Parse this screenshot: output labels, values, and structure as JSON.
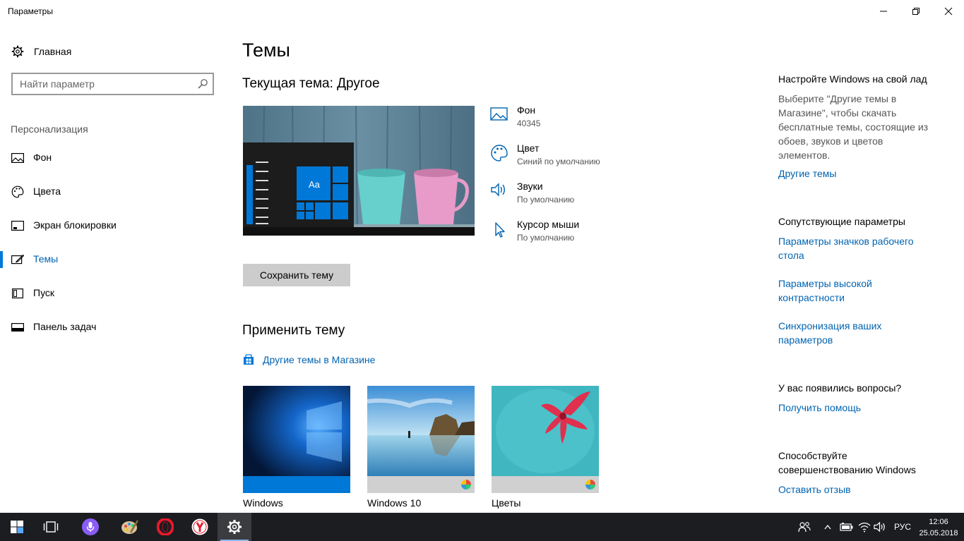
{
  "window": {
    "title": "Параметры"
  },
  "sidebar": {
    "home": "Главная",
    "search_placeholder": "Найти параметр",
    "section": "Персонализация",
    "items": [
      {
        "label": "Фон",
        "icon": "picture-icon"
      },
      {
        "label": "Цвета",
        "icon": "palette-icon"
      },
      {
        "label": "Экран блокировки",
        "icon": "lock-screen-icon"
      },
      {
        "label": "Темы",
        "icon": "themes-icon",
        "active": true
      },
      {
        "label": "Пуск",
        "icon": "start-icon"
      },
      {
        "label": "Панель задач",
        "icon": "taskbar-icon"
      }
    ]
  },
  "main": {
    "title": "Темы",
    "current_theme": "Текущая тема: Другое",
    "preview_tile_text": "Aa",
    "props": [
      {
        "name": "Фон",
        "value": "40345",
        "icon": "picture-icon"
      },
      {
        "name": "Цвет",
        "value": "Синий по умолчанию",
        "icon": "palette-icon"
      },
      {
        "name": "Звуки",
        "value": "По умолчанию",
        "icon": "speaker-icon"
      },
      {
        "name": "Курсор мыши",
        "value": "По умолчанию",
        "icon": "cursor-icon"
      }
    ],
    "save_button": "Сохранить тему",
    "apply_title": "Применить тему",
    "store_link": "Другие темы в Магазине",
    "themes": [
      {
        "name": "Windows"
      },
      {
        "name": "Windows 10"
      },
      {
        "name": "Цветы"
      }
    ]
  },
  "right": {
    "customize_title": "Настройте Windows на свой лад",
    "customize_text_lines": [
      "Выберите \"Другие темы в",
      "Магазине\", чтобы скачать",
      "бесплатные темы, состоящие из",
      "обоев, звуков и цветов",
      "элементов."
    ],
    "other_themes_link": "Другие темы",
    "related_title": "Сопутствующие параметры",
    "related_links": [
      [
        "Параметры значков рабочего",
        "стола"
      ],
      [
        "Параметры высокой",
        "контрастности"
      ],
      [
        "Синхронизация ваших",
        "параметров"
      ]
    ],
    "questions_title": "У вас появились вопросы?",
    "help_link": "Получить помощь",
    "improve_lines": [
      "Способствуйте",
      "совершенствованию Windows"
    ],
    "feedback_link": "Оставить отзыв"
  },
  "taskbar": {
    "lang": "РУС",
    "time": "12:06",
    "date": "25.05.2018"
  },
  "colors": {
    "accent": "#0078d7",
    "link": "#0063b1",
    "taskbar": "#1b1d21"
  }
}
